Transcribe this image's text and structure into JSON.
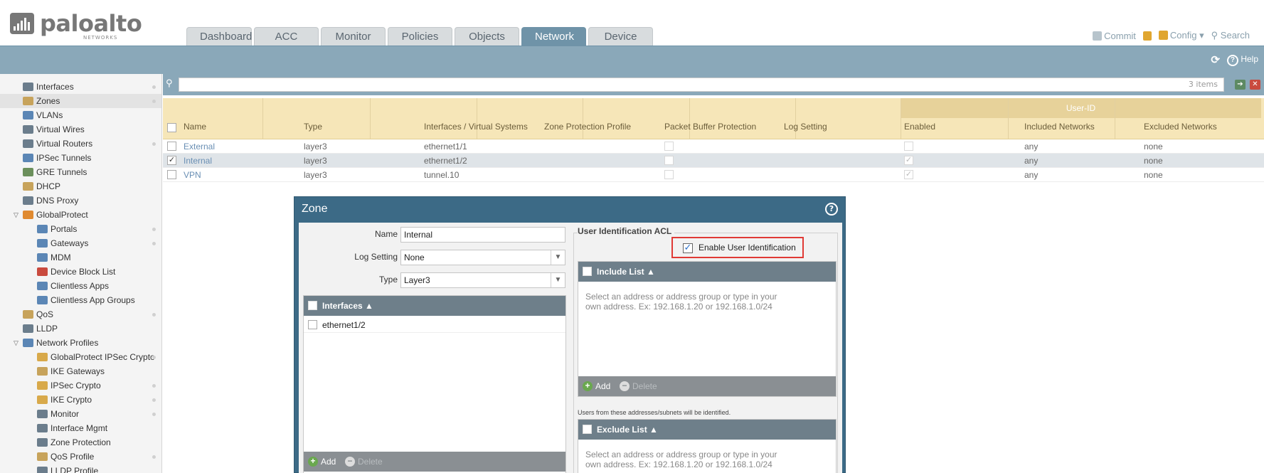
{
  "header": {
    "brand": "paloalto",
    "brand_sub": "NETWORKS",
    "tabs": [
      {
        "label": "Dashboard",
        "active": false
      },
      {
        "label": "ACC",
        "active": false
      },
      {
        "label": "Monitor",
        "active": false
      },
      {
        "label": "Policies",
        "active": false
      },
      {
        "label": "Objects",
        "active": false
      },
      {
        "label": "Network",
        "active": true
      },
      {
        "label": "Device",
        "active": false
      }
    ],
    "actions": {
      "commit": "Commit",
      "config": "Config",
      "search": "Search"
    },
    "help": "Help"
  },
  "sidebar": {
    "items": [
      {
        "label": "Interfaces",
        "icon": "interfaces-icon"
      },
      {
        "label": "Zones",
        "icon": "zones-icon"
      },
      {
        "label": "VLANs",
        "icon": "vlans-icon"
      },
      {
        "label": "Virtual Wires",
        "icon": "virtual-wires-icon"
      },
      {
        "label": "Virtual Routers",
        "icon": "virtual-routers-icon"
      },
      {
        "label": "IPSec Tunnels",
        "icon": "ipsec-tunnels-icon"
      },
      {
        "label": "GRE Tunnels",
        "icon": "gre-tunnels-icon"
      },
      {
        "label": "DHCP",
        "icon": "dhcp-icon"
      },
      {
        "label": "DNS Proxy",
        "icon": "dns-proxy-icon"
      },
      {
        "label": "GlobalProtect",
        "icon": "globalprotect-icon"
      },
      {
        "label": "Portals",
        "icon": "portals-icon"
      },
      {
        "label": "Gateways",
        "icon": "gateways-icon"
      },
      {
        "label": "MDM",
        "icon": "mdm-icon"
      },
      {
        "label": "Device Block List",
        "icon": "device-block-list-icon"
      },
      {
        "label": "Clientless Apps",
        "icon": "clientless-apps-icon"
      },
      {
        "label": "Clientless App Groups",
        "icon": "clientless-app-groups-icon"
      },
      {
        "label": "QoS",
        "icon": "qos-icon"
      },
      {
        "label": "LLDP",
        "icon": "lldp-icon"
      },
      {
        "label": "Network Profiles",
        "icon": "network-profiles-icon"
      },
      {
        "label": "GlobalProtect IPSec Crypto",
        "icon": "lock-icon"
      },
      {
        "label": "IKE Gateways",
        "icon": "ike-gateways-icon"
      },
      {
        "label": "IPSec Crypto",
        "icon": "lock-icon"
      },
      {
        "label": "IKE Crypto",
        "icon": "lock-icon"
      },
      {
        "label": "Monitor",
        "icon": "monitor-icon"
      },
      {
        "label": "Interface Mgmt",
        "icon": "interface-mgmt-icon"
      },
      {
        "label": "Zone Protection",
        "icon": "zone-protection-icon"
      },
      {
        "label": "QoS Profile",
        "icon": "qos-profile-icon"
      },
      {
        "label": "LLDP Profile",
        "icon": "lldp-profile-icon"
      }
    ]
  },
  "search": {
    "count_label": "3 items"
  },
  "zones_table": {
    "user_id_group": "User-ID",
    "columns": [
      "Name",
      "Type",
      "Interfaces / Virtual Systems",
      "Zone Protection Profile",
      "Packet Buffer Protection",
      "Log Setting",
      "Enabled",
      "Included Networks",
      "Excluded Networks"
    ],
    "rows": [
      {
        "name": "External",
        "type": "layer3",
        "interfaces": "ethernet1/1",
        "zone_protection": "",
        "log_setting": "",
        "selected": false,
        "pbp": false,
        "uid_enabled": false,
        "included": "any",
        "excluded": "none"
      },
      {
        "name": "Internal",
        "type": "layer3",
        "interfaces": "ethernet1/2",
        "zone_protection": "",
        "log_setting": "",
        "selected": true,
        "pbp": false,
        "uid_enabled": true,
        "included": "any",
        "excluded": "none"
      },
      {
        "name": "VPN",
        "type": "layer3",
        "interfaces": "tunnel.10",
        "zone_protection": "",
        "log_setting": "",
        "selected": false,
        "pbp": false,
        "uid_enabled": true,
        "included": "any",
        "excluded": "none"
      }
    ]
  },
  "zone_dialog": {
    "title": "Zone",
    "name_label": "Name",
    "name_value": "Internal",
    "log_setting_label": "Log Setting",
    "log_setting_value": "None",
    "type_label": "Type",
    "type_value": "Layer3",
    "interfaces_header": "Interfaces",
    "interfaces": [
      "ethernet1/2"
    ],
    "add_label": "Add",
    "delete_label": "Delete",
    "uid_legend": "User Identification ACL",
    "enable_uid_label": "Enable User Identification",
    "enable_uid_checked": true,
    "include_header": "Include List",
    "include_hint": "Select an address or address group or type in your own address. Ex: 192.168.1.20 or 192.168.1.0/24",
    "include_note": "Users from these addresses/subnets will be identified.",
    "exclude_header": "Exclude List",
    "exclude_hint": "Select an address or address group or type in your own address. Ex: 192.168.1.20 or 192.168.1.0/24"
  }
}
